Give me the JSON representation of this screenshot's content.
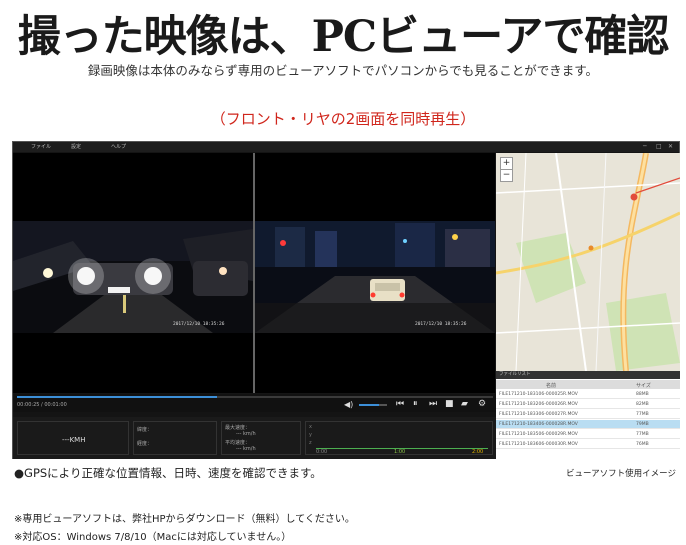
{
  "headline": "撮った映像は、PCビューアで確認",
  "subline": "録画映像は本体のみならず専用のビューアソフトでパソコンからでも見ることができます。",
  "caption": "（フロント・リヤの2画面を同時再生）",
  "app": {
    "menu": [
      "ファイル",
      "設定",
      "ヘルプ"
    ],
    "window_controls": [
      "─",
      "□",
      "✕"
    ],
    "front_timestamp": "2017/12/10 18:35:26",
    "rear_timestamp": "2017/12/10 18:35:26",
    "time_display": "00:00:25 / 00:01:00",
    "playback_progress": 0.42,
    "volume_level": 0.7,
    "speed_label": "---KMH",
    "info_labels": [
      "緯度：",
      "経度：",
      "最大速度：",
      "平均速度："
    ],
    "speed_values": [
      "--- km/h",
      "--- km/h"
    ],
    "graph_labels": [
      "x",
      "y",
      "z"
    ],
    "graph_ticks": [
      "0:00",
      "1:00",
      "2:00"
    ],
    "file_list": {
      "title": "ファイルリスト",
      "headers": [
        "名前",
        "サイズ"
      ],
      "rows": [
        {
          "name": "FILE171210-183106-000025R.MOV",
          "size": "88MB",
          "selected": false
        },
        {
          "name": "FILE171210-183206-000026R.MOV",
          "size": "82MB",
          "selected": false
        },
        {
          "name": "FILE171210-183306-000027R.MOV",
          "size": "77MB",
          "selected": false
        },
        {
          "name": "FILE171210-183406-000028R.MOV",
          "size": "79MB",
          "selected": true
        },
        {
          "name": "FILE171210-183506-000029R.MOV",
          "size": "77MB",
          "selected": false
        },
        {
          "name": "FILE171210-183606-000030R.MOV",
          "size": "76MB",
          "selected": false
        }
      ]
    }
  },
  "gps_note": "●GPSにより正確な位置情報、日時、速度を確認できます。",
  "image_note": "ビューアソフト使用イメージ",
  "footnote1": "※専用ビューアソフトは、弊社HPからダウンロード（無料）してください。",
  "footnote2": "※対応OS：Windows 7/8/10（Macには対応していません。）",
  "colors": {
    "accent": "#d0261c",
    "map_road": "#f4b860",
    "selected_row": "#b9ddf2"
  }
}
